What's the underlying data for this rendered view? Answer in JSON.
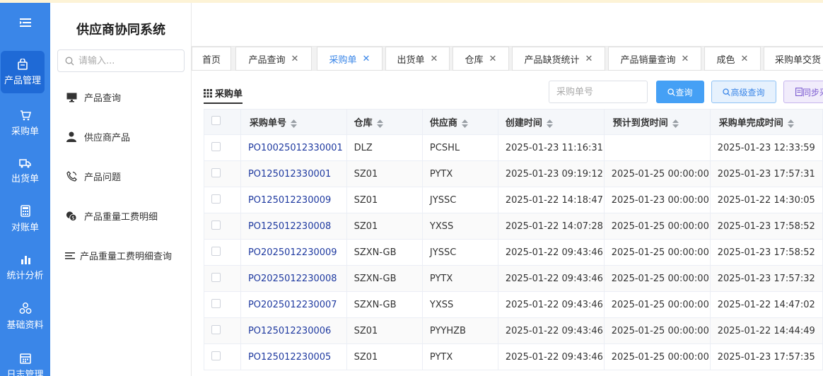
{
  "app": {
    "title": "供应商协同系统"
  },
  "rail": [
    {
      "label": "产品管理",
      "icon": "bag-icon",
      "active": true
    },
    {
      "label": "采购单",
      "icon": "cart-icon"
    },
    {
      "label": "出货单",
      "icon": "truck-icon"
    },
    {
      "label": "对账单",
      "icon": "calculator-icon"
    },
    {
      "label": "统计分析",
      "icon": "bar-chart-icon"
    },
    {
      "label": "基础资料",
      "icon": "cubes-icon"
    },
    {
      "label": "日志管理",
      "icon": "calendar-icon"
    }
  ],
  "submenu": {
    "search_placeholder": "请输入...",
    "items": [
      {
        "label": "产品查询",
        "icon": "monitor-icon"
      },
      {
        "label": "供应商产品",
        "icon": "user-icon"
      },
      {
        "label": "产品问题",
        "icon": "phone-icon"
      },
      {
        "label": "产品重量工费明细",
        "icon": "coins-icon"
      },
      {
        "label": "产品重量工费明细查询",
        "icon": "list-icon"
      }
    ]
  },
  "tabs": [
    {
      "label": "首页",
      "closable": false
    },
    {
      "label": "产品查询",
      "closable": true
    },
    {
      "label": "采购单",
      "closable": true,
      "active": true
    },
    {
      "label": "出货单",
      "closable": true
    },
    {
      "label": "仓库",
      "closable": true
    },
    {
      "label": "产品缺货统计",
      "closable": true
    },
    {
      "label": "产品销量查询",
      "closable": true
    },
    {
      "label": "成色",
      "closable": true
    },
    {
      "label": "采购单交货",
      "closable": false
    }
  ],
  "page": {
    "label": "采购单",
    "po_placeholder": "采购单号",
    "query_label": "查询",
    "adv_query_label": "高级查询",
    "sync_label": "同步采"
  },
  "table": {
    "columns": [
      "采购单号",
      "仓库",
      "供应商",
      "创建时间",
      "预计到货时间",
      "采购单完成时间"
    ],
    "rows": [
      [
        "PO10025012330001",
        "DLZ",
        "PCSHL",
        "2025-01-23 11:16:31",
        "",
        "2025-01-23 12:33:59"
      ],
      [
        "PO125012330001",
        "SZ01",
        "PYTX",
        "2025-01-23 09:19:12",
        "2025-01-25 00:00:00",
        "2025-01-23 17:57:31"
      ],
      [
        "PO125012230009",
        "SZ01",
        "JYSSC",
        "2025-01-22 14:18:47",
        "2025-01-23 00:00:00",
        "2025-01-22 14:30:05"
      ],
      [
        "PO125012230008",
        "SZ01",
        "YXSS",
        "2025-01-22 14:07:28",
        "2025-01-25 00:00:00",
        "2025-01-23 17:58:52"
      ],
      [
        "PO2025012230009",
        "SZXN-GB",
        "JYSSC",
        "2025-01-22 09:43:46",
        "2025-01-25 00:00:00",
        "2025-01-23 17:58:52"
      ],
      [
        "PO2025012230008",
        "SZXN-GB",
        "PYTX",
        "2025-01-22 09:43:46",
        "2025-01-25 00:00:00",
        "2025-01-23 17:57:32"
      ],
      [
        "PO2025012230007",
        "SZXN-GB",
        "YXSS",
        "2025-01-22 09:43:46",
        "2025-01-25 00:00:00",
        "2025-01-22 14:47:02"
      ],
      [
        "PO125012230006",
        "SZ01",
        "PYYHZB",
        "2025-01-22 09:43:46",
        "2025-01-25 00:00:00",
        "2025-01-22 14:44:49"
      ],
      [
        "PO125012230005",
        "SZ01",
        "PYTX",
        "2025-01-22 09:43:46",
        "2025-01-25 00:00:00",
        "2025-01-23 17:57:35"
      ]
    ]
  },
  "colors": {
    "rail": "#3a86e8",
    "rail_active": "#1f6ad6",
    "link": "#1f3aa0",
    "primary": "#45a0f5"
  }
}
